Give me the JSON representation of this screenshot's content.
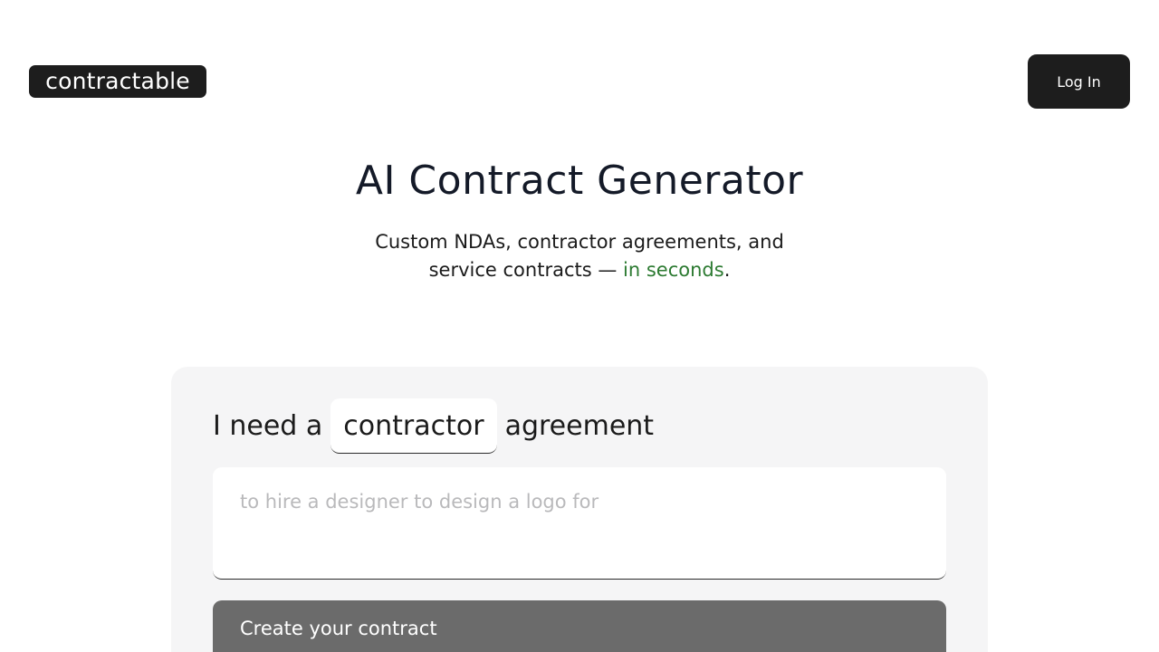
{
  "header": {
    "logo_text": "contractable",
    "login_label": "Log In"
  },
  "hero": {
    "title": "AI Contract Generator",
    "subtitle_line1": "Custom NDAs, contractor agreements, and",
    "subtitle_line2_prefix": "service contracts — ",
    "subtitle_highlight": "in seconds",
    "subtitle_suffix": ".",
    "highlight_color": "#2c7a31"
  },
  "form": {
    "prefix": "I need a",
    "contract_type": "contractor",
    "suffix": "agreement",
    "description_value": "",
    "description_placeholder": "to hire a designer to design a logo for",
    "submit_label": "Create your contract"
  }
}
